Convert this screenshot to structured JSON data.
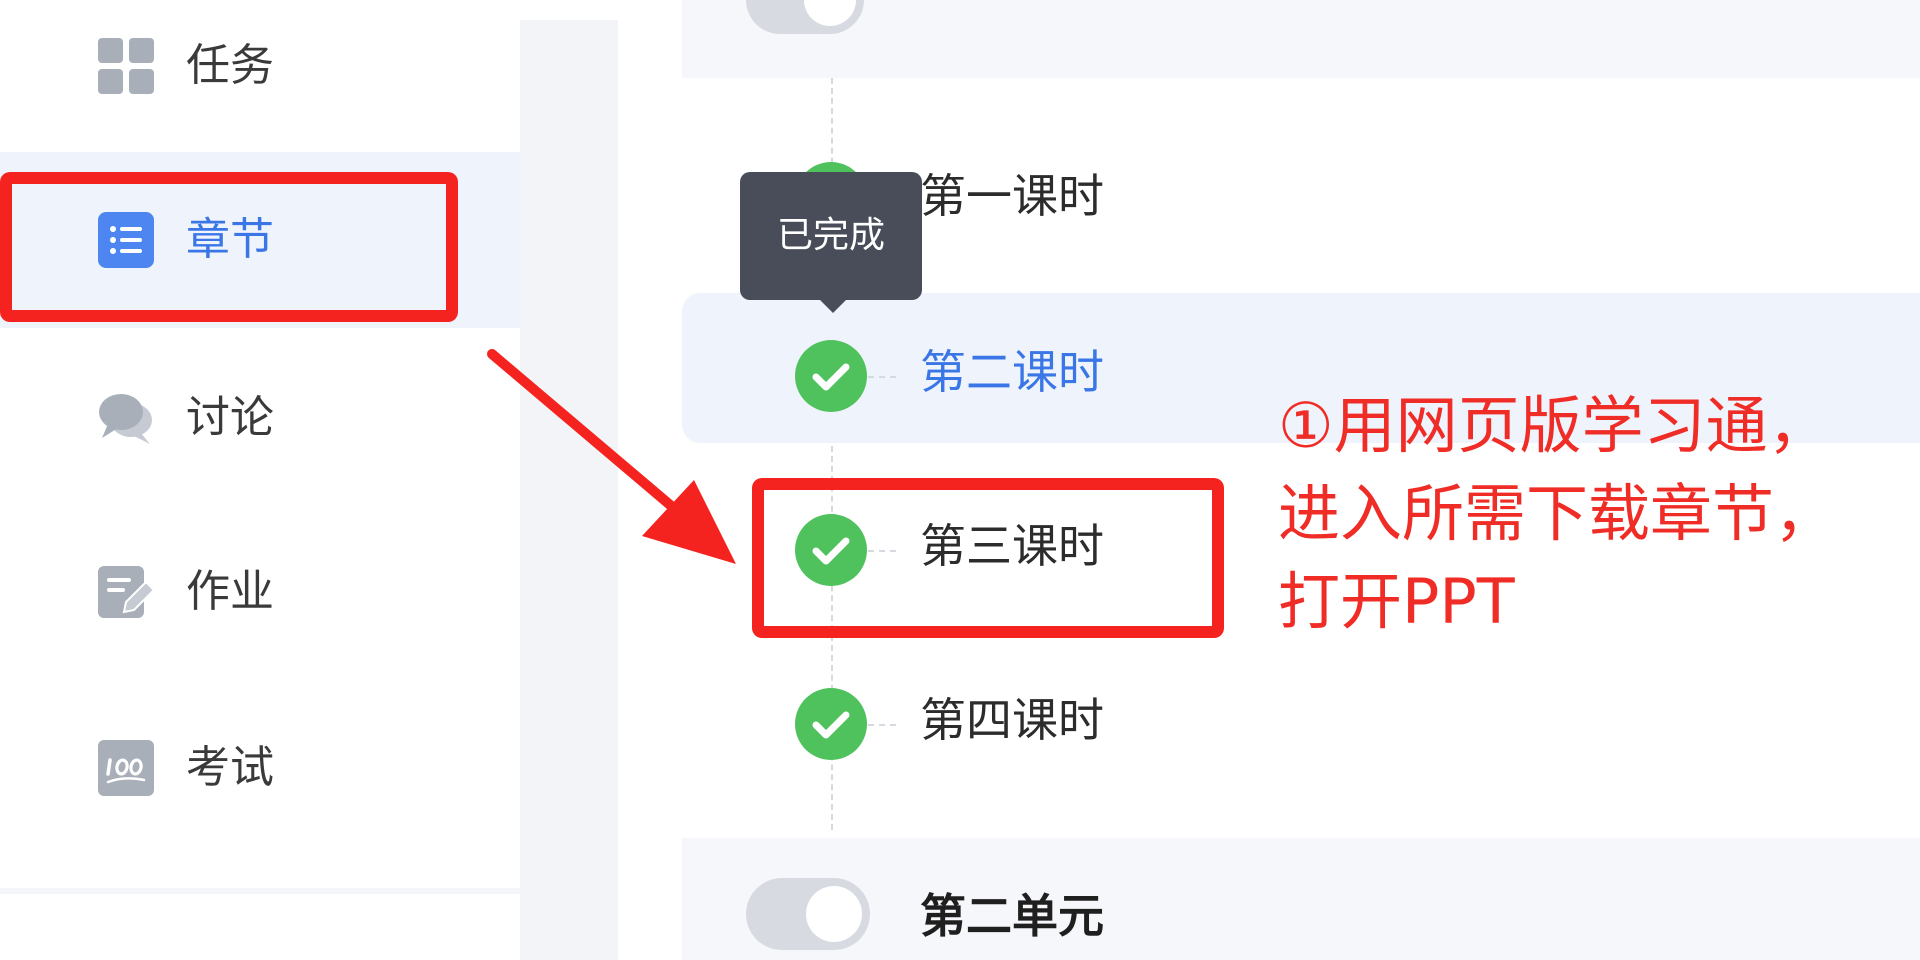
{
  "sidebar": {
    "items": [
      {
        "label": "任务",
        "icon": "grid-icon",
        "active": false
      },
      {
        "label": "章节",
        "icon": "list-icon",
        "active": true
      },
      {
        "label": "讨论",
        "icon": "chat-bubbles-icon",
        "active": false
      },
      {
        "label": "作业",
        "icon": "assignment-edit-icon",
        "active": false
      },
      {
        "label": "考试",
        "icon": "exam-100-icon",
        "active": false
      }
    ]
  },
  "content": {
    "tooltip": "已完成",
    "lessons": [
      {
        "title": "第一课时",
        "status": "completed"
      },
      {
        "title": "第二课时",
        "status": "completed",
        "active": true
      },
      {
        "title": "第三课时",
        "status": "completed"
      },
      {
        "title": "第四课时",
        "status": "completed"
      }
    ],
    "next_unit": {
      "title": "第二单元"
    }
  },
  "annotation": {
    "lines": [
      "①用网页版学习通，",
      "进入所需下载章节，",
      "打开PPT"
    ]
  },
  "colors": {
    "accent_blue": "#3a76e6",
    "check_green": "#4fc25d",
    "annotation_red": "#f5231f",
    "tooltip_bg": "#494d5a",
    "active_row_bg": "#eff4fc"
  }
}
